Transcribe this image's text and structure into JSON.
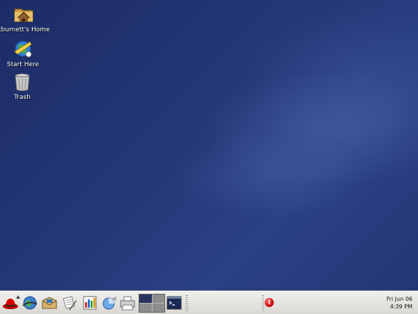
{
  "desktop": {
    "icons": [
      {
        "label": "kburnett's Home",
        "icon": "home-folder-icon"
      },
      {
        "label": "Start Here",
        "icon": "start-here-icon"
      },
      {
        "label": "Trash",
        "icon": "trash-icon"
      }
    ]
  },
  "panel": {
    "launchers": [
      "redhat-main-menu-icon",
      "web-browser-icon",
      "email-icon",
      "word-processor-icon",
      "presentation-icon",
      "spreadsheet-icon",
      "print-manager-icon"
    ],
    "workspaces": {
      "count": 4,
      "active": 1
    },
    "terminal_icon": "terminal-icon",
    "alert_icon": "update-alert-icon",
    "alert_glyph": "!",
    "clock": {
      "date": "Fri  Jun 06",
      "time": "4:39 PM"
    }
  },
  "colors": {
    "desktop_blue": "#243777",
    "panel_gray": "#d9d8d3"
  }
}
